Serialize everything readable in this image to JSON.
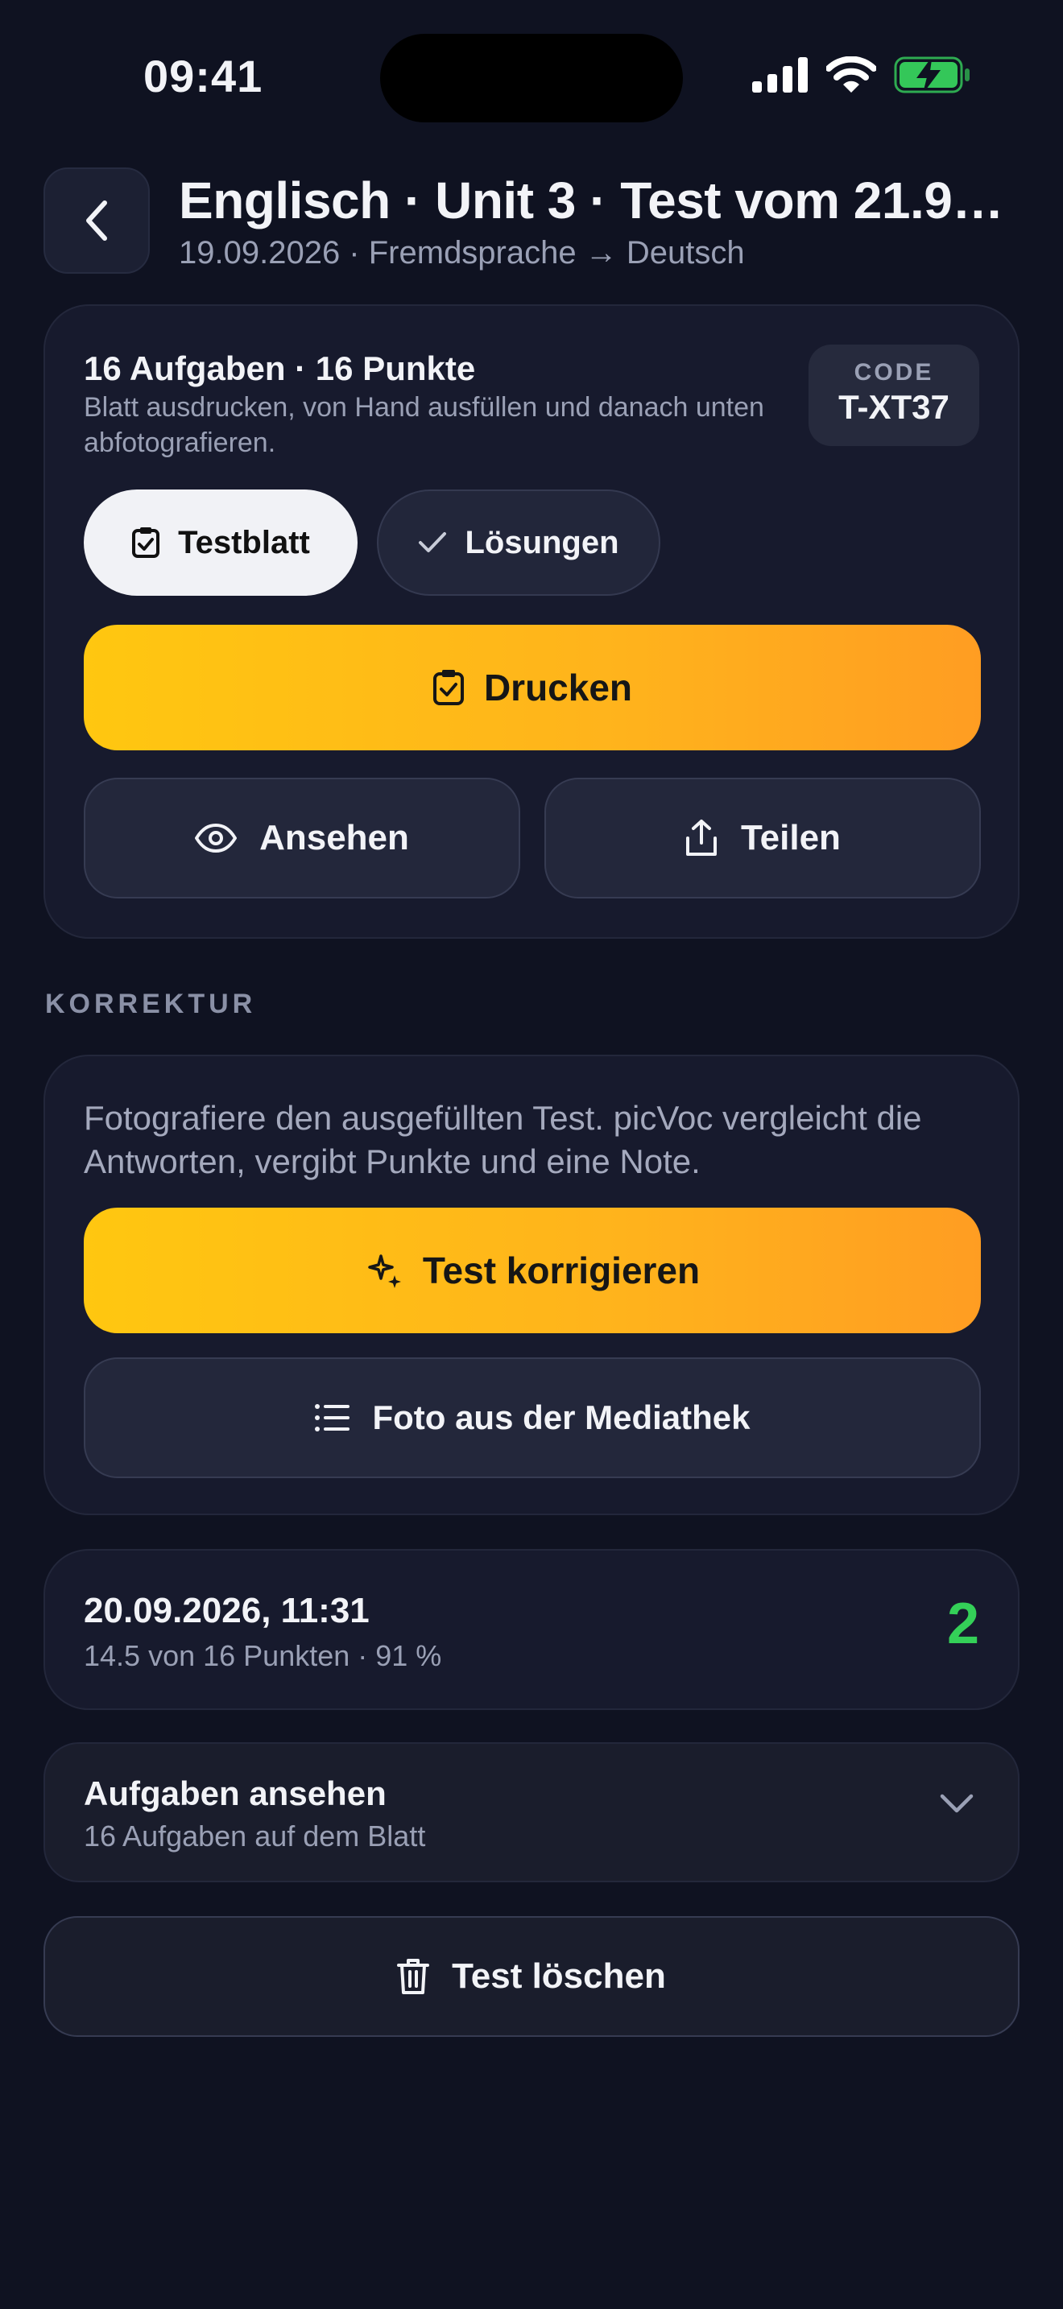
{
  "status_bar": {
    "time": "09:41"
  },
  "header": {
    "title": "Englisch · Unit 3 · Test vom 21.9.2…",
    "subtitle": "19.09.2026 · Fremdsprache → Deutsch"
  },
  "test_card": {
    "summary": "16 Aufgaben · 16 Punkte",
    "description": "Blatt ausdrucken, von Hand ausfüllen und danach unten abfotografieren.",
    "code_label": "CODE",
    "code_value": "T-XT37",
    "tabs": [
      {
        "label": "Testblatt",
        "selected": true
      },
      {
        "label": "Lösungen",
        "selected": false
      }
    ],
    "print_label": "Drucken",
    "view_label": "Ansehen",
    "share_label": "Teilen"
  },
  "correction": {
    "section_label": "KORREKTUR",
    "description": "Fotografiere den ausgefüllten Test. picVoc vergleicht die Antworten, vergibt Punkte und eine Note.",
    "correct_label": "Test korrigieren",
    "library_label": "Foto aus der Mediathek"
  },
  "result": {
    "datetime": "20.09.2026, 11:31",
    "points": "14.5 von 16 Punkten · 91 %",
    "grade": "2"
  },
  "tasks": {
    "title": "Aufgaben ansehen",
    "subtitle": "16 Aufgaben auf dem Blatt"
  },
  "delete_label": "Test löschen",
  "colors": {
    "background": "#0f1221",
    "accent_start": "#ffc710",
    "accent_end": "#ff9d22",
    "grade_green": "#34d058",
    "battery_green": "#34c759"
  }
}
